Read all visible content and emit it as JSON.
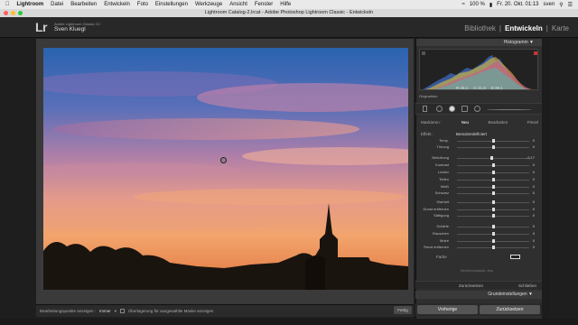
{
  "menubar": {
    "items": [
      "Lightroom",
      "Datei",
      "Bearbeiten",
      "Entwickeln",
      "Foto",
      "Einstellungen",
      "Werkzeuge",
      "Ansicht",
      "Fenster",
      "Hilfe"
    ],
    "battery": "100 %",
    "clock": "Fr. 20. Okt. 01:13",
    "user": "sven"
  },
  "window": {
    "title": "Lightroom Catalog-2.lrcat - Adobe Photoshop Lightroom Classic - Entwickeln"
  },
  "identity": {
    "logo": "Lr",
    "product": "Adobe Lightroom Classic CC",
    "user": "Sven Kluegl"
  },
  "modules": {
    "items": [
      "Bibliothek",
      "Entwickeln",
      "Karte"
    ],
    "sep": "|",
    "active": 1
  },
  "histogram": {
    "title": "Histogramm",
    "r": "R  46,1",
    "g": "G  41,8",
    "b": "B  39,1",
    "original": "Originalfoto"
  },
  "mask": {
    "label": "Maskieren :",
    "items": [
      "Neu",
      "Bearbeiten",
      "Pinsel"
    ],
    "selected": 0
  },
  "effect": {
    "label": "Effekt :",
    "value": "Benutzerdefiniert"
  },
  "sliders": [
    {
      "label": "Temp.",
      "value": "0",
      "pos": 0.5
    },
    {
      "label": "Tönung",
      "value": "0",
      "pos": 0.5
    },
    {
      "label": "Belichtung",
      "value": "- 0,17",
      "pos": 0.48
    },
    {
      "label": "Kontrast",
      "value": "0",
      "pos": 0.5
    },
    {
      "label": "Lichter",
      "value": "0",
      "pos": 0.5
    },
    {
      "label": "Tiefen",
      "value": "0",
      "pos": 0.5
    },
    {
      "label": "Weiß",
      "value": "0",
      "pos": 0.5
    },
    {
      "label": "Schwarz",
      "value": "0",
      "pos": 0.5
    },
    {
      "label": "Klarheit",
      "value": "0",
      "pos": 0.5
    },
    {
      "label": "Dunst entfernen",
      "value": "0",
      "pos": 0.5
    },
    {
      "label": "Sättigung",
      "value": "0",
      "pos": 0.5
    },
    {
      "label": "Schärfe",
      "value": "0",
      "pos": 0.5
    },
    {
      "label": "Rauschen",
      "value": "0",
      "pos": 0.5
    },
    {
      "label": "Moiré",
      "value": "0",
      "pos": 0.5
    },
    {
      "label": "Rand entfernen",
      "value": "0",
      "pos": 0.5
    }
  ],
  "color": {
    "label": "Farbe"
  },
  "brush_label": "Bereichsmaske: Aus",
  "reset": {
    "left": "Zurücksetzen",
    "right": "Schließen"
  },
  "basic_panel": {
    "title": "Grundeinstellungen"
  },
  "buttons": {
    "prev": "Vorherige",
    "reset": "Zurücksetzen"
  },
  "toolbar": {
    "pins_label": "Bearbeitungspunkte anzeigen :",
    "pins_value": "Immer",
    "overlay_label": "Überlagerung für ausgewählte Maske anzeigen",
    "done": "Fertig"
  },
  "colors": {
    "accent_red": "#ff5f57",
    "accent_yellow": "#febc2e",
    "accent_green": "#28c840"
  }
}
